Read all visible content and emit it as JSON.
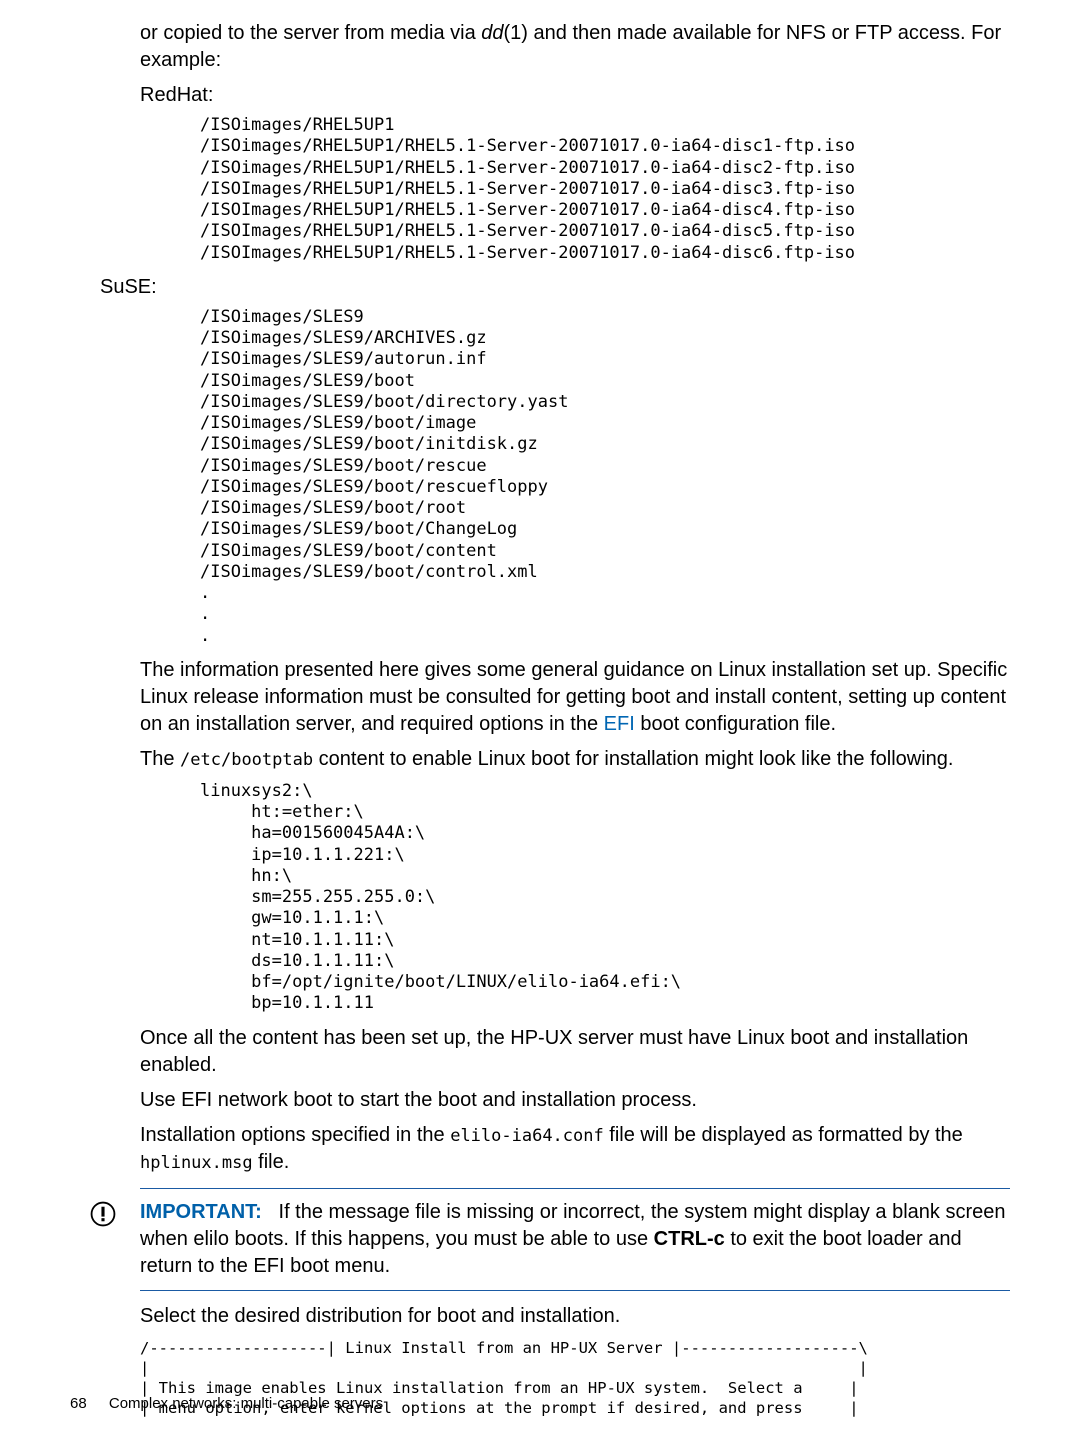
{
  "intro": "or copied to the server from media via dd(1) and then made available for NFS or FTP access. For example:",
  "redhat_label": "RedHat:",
  "redhat_code": "/ISOimages/RHEL5UP1\n/ISOimages/RHEL5UP1/RHEL5.1-Server-20071017.0-ia64-disc1-ftp.iso\n/ISOimages/RHEL5UP1/RHEL5.1-Server-20071017.0-ia64-disc2-ftp.iso\n/ISOImages/RHEL5UP1/RHEL5.1-Server-20071017.0-ia64-disc3.ftp-iso\n/ISOImages/RHEL5UP1/RHEL5.1-Server-20071017.0-ia64-disc4.ftp-iso\n/ISOImages/RHEL5UP1/RHEL5.1-Server-20071017.0-ia64-disc5.ftp-iso\n/ISOImages/RHEL5UP1/RHEL5.1-Server-20071017.0-ia64-disc6.ftp-iso",
  "suse_label": "SuSE:",
  "suse_code": "/ISOimages/SLES9\n/ISOimages/SLES9/ARCHIVES.gz\n/ISOimages/SLES9/autorun.inf\n/ISOimages/SLES9/boot\n/ISOimages/SLES9/boot/directory.yast\n/ISOimages/SLES9/boot/image\n/ISOimages/SLES9/boot/initdisk.gz\n/ISOimages/SLES9/boot/rescue\n/ISOimages/SLES9/boot/rescuefloppy\n/ISOimages/SLES9/boot/root\n/ISOimages/SLES9/boot/ChangeLog\n/ISOimages/SLES9/boot/content\n/ISOimages/SLES9/boot/control.xml\n.\n.\n.",
  "para1_a": "The information presented here gives some general guidance on Linux installation set up. Specific Linux release information must be consulted for getting boot and install content, setting up content on an installation server, and required options in the ",
  "para1_link": "EFI",
  "para1_b": " boot configuration file.",
  "para2_a": "The ",
  "para2_code": "/etc/bootptab",
  "para2_b": " content to enable Linux boot for installation might look like the following.",
  "bootptab_code": "linuxsys2:\\\n     ht:=ether:\\\n     ha=001560045A4A:\\\n     ip=10.1.1.221:\\\n     hn:\\\n     sm=255.255.255.0:\\\n     gw=10.1.1.1:\\\n     nt=10.1.1.11:\\\n     ds=10.1.1.11:\\\n     bf=/opt/ignite/boot/LINUX/elilo-ia64.efi:\\\n     bp=10.1.1.11",
  "para3": "Once all the content has been set up, the HP-UX server must have Linux boot and installation enabled.",
  "para4": "Use EFI network boot to start the boot and installation process.",
  "para5_a": "Installation options specified in the ",
  "para5_code1": "elilo-ia64.conf",
  "para5_b": " file will be displayed as formatted by the ",
  "para5_code2": "hplinux.msg",
  "para5_c": " file.",
  "important_label": "IMPORTANT:",
  "important_text_a": "If the message file is missing or incorrect, the system might display a blank screen when elilo boots. If this happens, you must be able to use ",
  "important_bold": "CTRL-c",
  "important_text_b": " to exit the boot loader and return to the EFI boot menu.",
  "para6": "Select the desired distribution for boot and installation.",
  "menu_code": "/-------------------| Linux Install from an HP-UX Server |-------------------\\\n|                                                                            |\n| This image enables Linux installation from an HP-UX system.  Select a     |\n| menu option, enter kernel options at the prompt if desired, and press     |",
  "footer_pagenum": "68",
  "footer_text": "Complex networks: multi-capable servers"
}
